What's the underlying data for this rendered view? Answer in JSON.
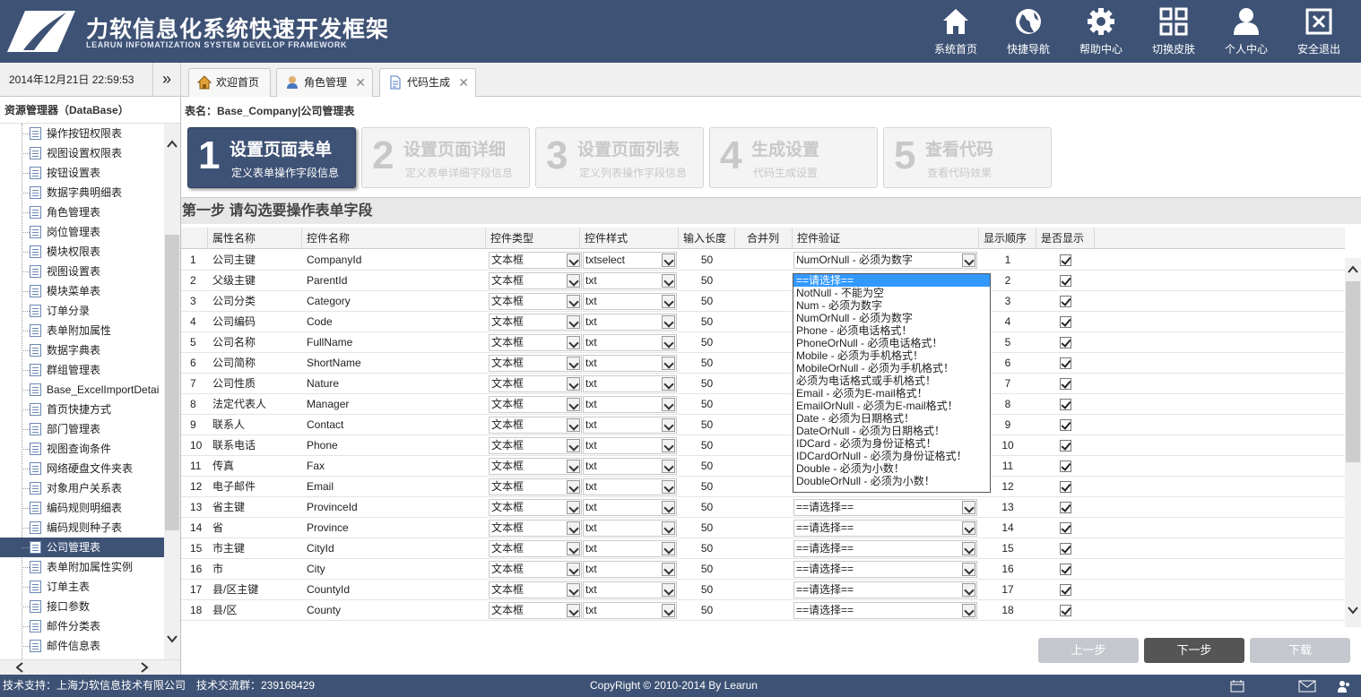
{
  "header": {
    "title": "力软信息化系统快速开发框架",
    "subtitle": "LEARUN INFOMATIZATION SYSTEM DEVELOP FRAMEWORK",
    "nav": [
      {
        "label": "系统首页",
        "icon": "home-icon"
      },
      {
        "label": "快捷导航",
        "icon": "globe-icon"
      },
      {
        "label": "帮助中心",
        "icon": "gear-icon"
      },
      {
        "label": "切换皮肤",
        "icon": "grid-icon"
      },
      {
        "label": "个人中心",
        "icon": "user-icon"
      },
      {
        "label": "安全退出",
        "icon": "close-box-icon"
      }
    ]
  },
  "toolbar": {
    "datetime": "2014年12月21日 22:59:53",
    "collapse": "»",
    "tabs": [
      {
        "label": "欢迎首页",
        "icon": "house-icon",
        "closable": false
      },
      {
        "label": "角色管理",
        "icon": "person-icon",
        "closable": true
      },
      {
        "label": "代码生成",
        "icon": "document-icon",
        "closable": true
      }
    ],
    "close": "✕"
  },
  "sidebar": {
    "title": "资源管理器（DataBase）",
    "selected_index": 21,
    "items": [
      "操作按钮权限表",
      "视图设置权限表",
      "按钮设置表",
      "数据字典明细表",
      "角色管理表",
      "岗位管理表",
      "模块权限表",
      "视图设置表",
      "模块菜单表",
      "订单分录",
      "表单附加属性",
      "数据字典表",
      "群组管理表",
      "Base_ExcelImportDetai",
      "首页快捷方式",
      "部门管理表",
      "视图查询条件",
      "网络硬盘文件夹表",
      "对象用户关系表",
      "编码规则明细表",
      "编码规则种子表",
      "公司管理表",
      "表单附加属性实例",
      "订单主表",
      "接口参数",
      "邮件分类表",
      "邮件信息表"
    ]
  },
  "main": {
    "table_info": "表名：Base_Company|公司管理表",
    "steps": [
      {
        "num": "1",
        "title": "设置页面表单",
        "desc": "定义表单操作字段信息",
        "active": true
      },
      {
        "num": "2",
        "title": "设置页面详细",
        "desc": "定义表单详细字段信息",
        "active": false
      },
      {
        "num": "3",
        "title": "设置页面列表",
        "desc": "定义列表操作字段信息",
        "active": false
      },
      {
        "num": "4",
        "title": "生成设置",
        "desc": "代码生成设置",
        "active": false
      },
      {
        "num": "5",
        "title": "查看代码",
        "desc": "查看代码效果",
        "active": false
      }
    ],
    "section_title": "第一步 请勾选要操作表单字段",
    "columns": [
      "属性名称",
      "控件名称",
      "控件类型",
      "控件样式",
      "输入长度",
      "合并列",
      "控件验证",
      "显示顺序",
      "是否显示"
    ],
    "rows": [
      {
        "no": "1",
        "attr": "公司主键",
        "name": "CompanyId",
        "type": "文本框",
        "style": "txtselect",
        "len": "50",
        "valid": "NumOrNull - 必须为数字",
        "order": "1",
        "show": true
      },
      {
        "no": "2",
        "attr": "父级主键",
        "name": "ParentId",
        "type": "文本框",
        "style": "txt",
        "len": "50",
        "valid": "",
        "order": "2",
        "show": true
      },
      {
        "no": "3",
        "attr": "公司分类",
        "name": "Category",
        "type": "文本框",
        "style": "txt",
        "len": "50",
        "valid": "",
        "order": "3",
        "show": true
      },
      {
        "no": "4",
        "attr": "公司编码",
        "name": "Code",
        "type": "文本框",
        "style": "txt",
        "len": "50",
        "valid": "",
        "order": "4",
        "show": true
      },
      {
        "no": "5",
        "attr": "公司名称",
        "name": "FullName",
        "type": "文本框",
        "style": "txt",
        "len": "50",
        "valid": "",
        "order": "5",
        "show": true
      },
      {
        "no": "6",
        "attr": "公司简称",
        "name": "ShortName",
        "type": "文本框",
        "style": "txt",
        "len": "50",
        "valid": "",
        "order": "6",
        "show": true
      },
      {
        "no": "7",
        "attr": "公司性质",
        "name": "Nature",
        "type": "文本框",
        "style": "txt",
        "len": "50",
        "valid": "",
        "order": "7",
        "show": true
      },
      {
        "no": "8",
        "attr": "法定代表人",
        "name": "Manager",
        "type": "文本框",
        "style": "txt",
        "len": "50",
        "valid": "",
        "order": "8",
        "show": true
      },
      {
        "no": "9",
        "attr": "联系人",
        "name": "Contact",
        "type": "文本框",
        "style": "txt",
        "len": "50",
        "valid": "",
        "order": "9",
        "show": true
      },
      {
        "no": "10",
        "attr": "联系电话",
        "name": "Phone",
        "type": "文本框",
        "style": "txt",
        "len": "50",
        "valid": "",
        "order": "10",
        "show": true
      },
      {
        "no": "11",
        "attr": "传真",
        "name": "Fax",
        "type": "文本框",
        "style": "txt",
        "len": "50",
        "valid": "",
        "order": "11",
        "show": true
      },
      {
        "no": "12",
        "attr": "电子邮件",
        "name": "Email",
        "type": "文本框",
        "style": "txt",
        "len": "50",
        "valid": "",
        "order": "12",
        "show": true
      },
      {
        "no": "13",
        "attr": "省主键",
        "name": "ProvinceId",
        "type": "文本框",
        "style": "txt",
        "len": "50",
        "valid": "==请选择==",
        "order": "13",
        "show": true
      },
      {
        "no": "14",
        "attr": "省",
        "name": "Province",
        "type": "文本框",
        "style": "txt",
        "len": "50",
        "valid": "==请选择==",
        "order": "14",
        "show": true
      },
      {
        "no": "15",
        "attr": "市主键",
        "name": "CityId",
        "type": "文本框",
        "style": "txt",
        "len": "50",
        "valid": "==请选择==",
        "order": "15",
        "show": true
      },
      {
        "no": "16",
        "attr": "市",
        "name": "City",
        "type": "文本框",
        "style": "txt",
        "len": "50",
        "valid": "==请选择==",
        "order": "16",
        "show": true
      },
      {
        "no": "17",
        "attr": "县/区主键",
        "name": "CountyId",
        "type": "文本框",
        "style": "txt",
        "len": "50",
        "valid": "==请选择==",
        "order": "17",
        "show": true
      },
      {
        "no": "18",
        "attr": "县/区",
        "name": "County",
        "type": "文本框",
        "style": "txt",
        "len": "50",
        "valid": "==请选择==",
        "order": "18",
        "show": true
      }
    ],
    "dropdown_options": [
      "==请选择==",
      "NotNull - 不能为空",
      "Num - 必须为数字",
      "NumOrNull - 必须为数字",
      "Phone - 必须电话格式！",
      "PhoneOrNull - 必须电话格式！",
      "Mobile - 必须为手机格式！",
      "MobileOrNull - 必须为手机格式！",
      "必须为电话格式或手机格式！",
      "Email - 必须为E-mail格式！",
      "EmailOrNull - 必须为E-mail格式！",
      "Date - 必须为日期格式！",
      "DateOrNull - 必须为日期格式！",
      "IDCard - 必须为身份证格式！",
      "IDCardOrNull - 必须为身份证格式！",
      "Double - 必须为小数！",
      "DoubleOrNull - 必须为小数！"
    ],
    "buttons": {
      "prev": "上一步",
      "next": "下一步",
      "download": "下载"
    }
  },
  "footer": {
    "support": "技术支持：上海力软信息技术有限公司　技术交流群：239168429",
    "copyright": "CopyRight © 2010-2014 By Learun"
  },
  "colors": {
    "primary": "#3e5275",
    "highlight": "#3399ff"
  }
}
